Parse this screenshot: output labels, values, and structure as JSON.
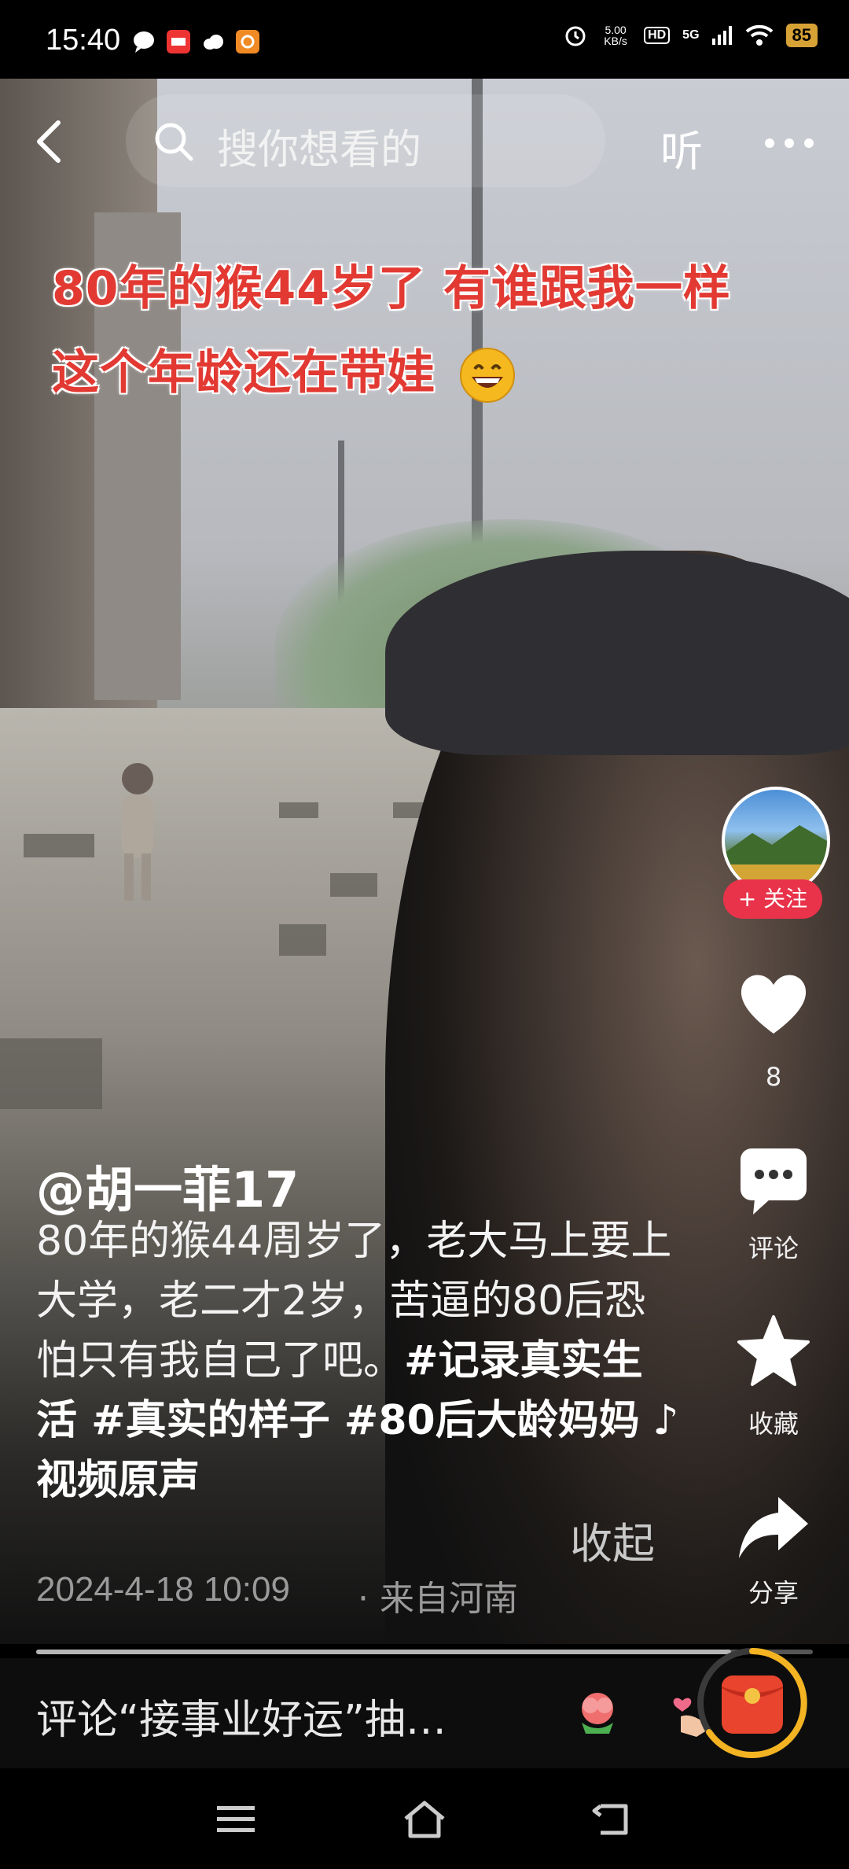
{
  "status_bar": {
    "time": "15:40",
    "net_speed": "5.00\nKB/s",
    "hd": "HD",
    "signal": "5G",
    "battery": "85"
  },
  "top_nav": {
    "search_placeholder": "搜你想看的",
    "listen_label": "听"
  },
  "overlay": {
    "line1": "80年的猴44岁了 有谁跟我一样",
    "line2": "这个年龄还在带娃"
  },
  "right_rail": {
    "follow_label": "+ 关注",
    "like_count": "8",
    "comment_label": "评论",
    "favorite_label": "收藏",
    "share_label": "分享"
  },
  "post": {
    "author": "@胡一菲17",
    "desc_plain": "80年的猴44周岁了，老大马上要上大学，老二才2岁，苦逼的80后恐怕只有我自己了吧。",
    "desc_tags": "#记录真实生活 #真实的样子 #80后大龄妈妈",
    "music": "♪ 视频原声",
    "collapse_label": "收起",
    "timestamp": "2024-4-18 10:09",
    "location": "· 来自河南",
    "progress": 0.895
  },
  "comment_bar": {
    "prompt": "评论“接事业好运”抽…"
  },
  "colors": {
    "overlay_text": "#e23a33",
    "follow_button": "#e8334a",
    "battery": "#d7a235"
  }
}
